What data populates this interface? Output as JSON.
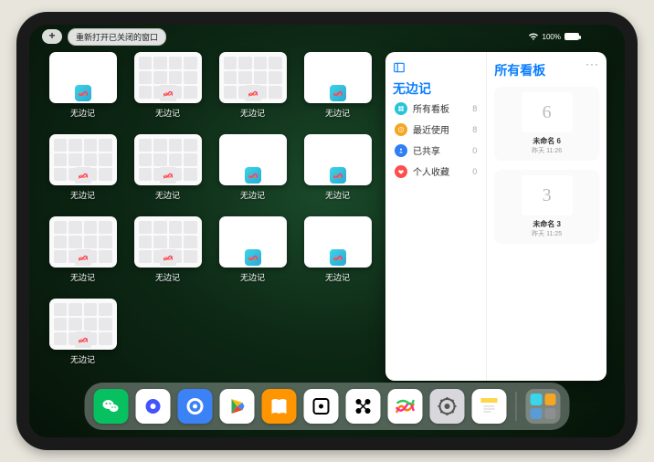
{
  "status": {
    "plus": "+",
    "reopen_pill": "重新打开已关闭的窗口",
    "battery_text": "100%"
  },
  "app_switcher": {
    "app_label": "无边记",
    "thumbs": [
      {
        "style": "blank"
      },
      {
        "style": "grid"
      },
      {
        "style": "grid"
      },
      {
        "style": "blank"
      },
      {
        "style": "grid"
      },
      {
        "style": "grid"
      },
      {
        "style": "blank"
      },
      {
        "style": "blank"
      },
      {
        "style": "grid"
      },
      {
        "style": "grid"
      },
      {
        "style": "blank"
      },
      {
        "style": "blank"
      },
      {
        "style": "grid"
      }
    ]
  },
  "panel": {
    "title_left": "无边记",
    "title_right": "所有看板",
    "more": "···",
    "sidebar": [
      {
        "label": "所有看板",
        "count": "8",
        "color": "#28c4d8"
      },
      {
        "label": "最近使用",
        "count": "8",
        "color": "#f5a623"
      },
      {
        "label": "已共享",
        "count": "0",
        "color": "#2f7ef6"
      },
      {
        "label": "个人收藏",
        "count": "0",
        "color": "#ff4d4d"
      }
    ],
    "boards": [
      {
        "glyph": "6",
        "name": "未命名 6",
        "date": "昨天 11:26"
      },
      {
        "glyph": "3",
        "name": "未命名 3",
        "date": "昨天 11:25"
      }
    ]
  },
  "dock": {
    "apps": [
      {
        "name": "wechat",
        "bg": "#07c160"
      },
      {
        "name": "quark",
        "bg": "#ffffff"
      },
      {
        "name": "browser",
        "bg": "#3b82f6"
      },
      {
        "name": "play",
        "bg": "#ffffff"
      },
      {
        "name": "books",
        "bg": "#ff9500"
      },
      {
        "name": "dice",
        "bg": "#ffffff"
      },
      {
        "name": "nodes",
        "bg": "#ffffff"
      },
      {
        "name": "freeform",
        "bg": "#ffffff"
      },
      {
        "name": "settings",
        "bg": "#d8d8dc"
      },
      {
        "name": "notes",
        "bg": "#ffffff"
      }
    ]
  }
}
